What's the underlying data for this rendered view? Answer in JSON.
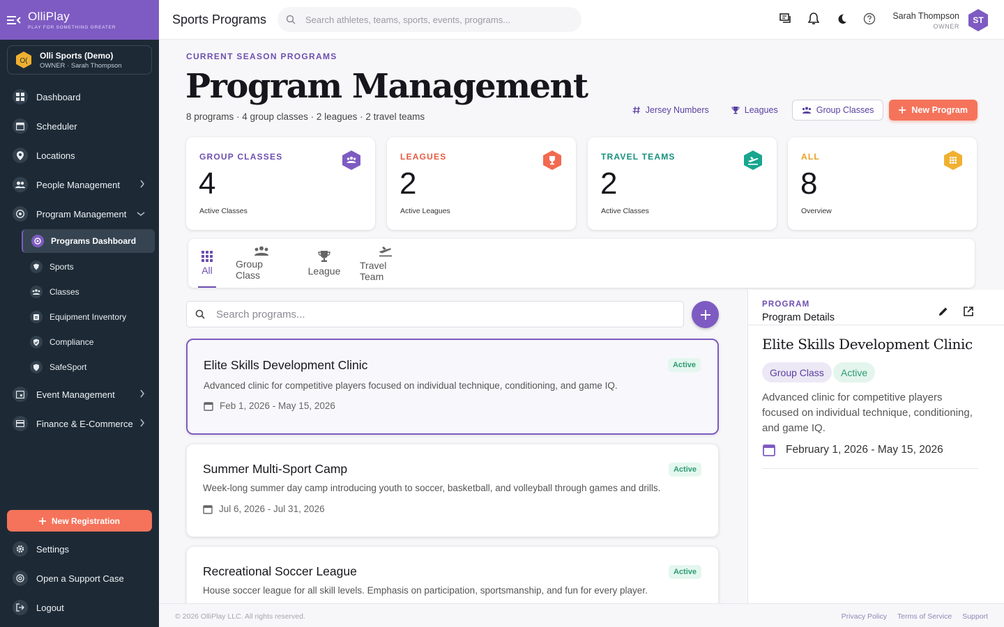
{
  "brand": {
    "name": "OlliPlay",
    "tagline": "PLAY FOR SOMETHING GREATER"
  },
  "org": {
    "name": "Olli Sports (Demo)",
    "subtitle": "OWNER · Sarah Thompson",
    "badge": "O("
  },
  "sidebar": {
    "items": [
      {
        "label": "Dashboard",
        "icon": "dashboard-icon"
      },
      {
        "label": "Scheduler",
        "icon": "calendar-icon"
      },
      {
        "label": "Locations",
        "icon": "location-pin-icon"
      },
      {
        "label": "People Management",
        "icon": "people-icon"
      },
      {
        "label": "Program Management",
        "icon": "sports-ball-icon"
      }
    ],
    "subitems": [
      {
        "label": "Programs Dashboard",
        "icon": "dashboard-icon"
      },
      {
        "label": "Sports",
        "icon": "shield-icon"
      },
      {
        "label": "Classes",
        "icon": "group-icon"
      },
      {
        "label": "Equipment Inventory",
        "icon": "clipboard-icon"
      },
      {
        "label": "Compliance",
        "icon": "shield-check-icon"
      },
      {
        "label": "SafeSport",
        "icon": "shield-icon"
      }
    ],
    "more": [
      {
        "label": "Event Management",
        "icon": "calendar-event-icon"
      },
      {
        "label": "Finance & E-Commerce",
        "icon": "credit-card-icon"
      }
    ],
    "new_registration": "New Registration",
    "bottom": [
      {
        "label": "Settings",
        "icon": "gear-icon"
      },
      {
        "label": "Open a Support Case",
        "icon": "support-icon"
      },
      {
        "label": "Logout",
        "icon": "logout-icon"
      }
    ]
  },
  "topbar": {
    "title": "Sports Programs",
    "search_placeholder": "Search athletes, teams, sports, events, programs...",
    "user_name": "Sarah Thompson",
    "user_role": "OWNER",
    "user_initials": "ST"
  },
  "header": {
    "eyebrow": "CURRENT SEASON PROGRAMS",
    "title": "Program Management",
    "summary": "8 programs · 4 group classes · 2 leagues · 2 travel teams",
    "actions": {
      "jersey": "Jersey Numbers",
      "leagues": "Leagues",
      "group_classes": "Group Classes",
      "new_program": "New Program"
    }
  },
  "stats": [
    {
      "label": "GROUP CLASSES",
      "value": "4",
      "sub": "Active Classes",
      "color": "#7e5bc2"
    },
    {
      "label": "LEAGUES",
      "value": "2",
      "sub": "Active Leagues",
      "color": "#f26a50"
    },
    {
      "label": "TRAVEL TEAMS",
      "value": "2",
      "sub": "Active Classes",
      "color": "#17a68f"
    },
    {
      "label": "ALL",
      "value": "8",
      "sub": "Overview",
      "color": "#f0b030"
    }
  ],
  "tabs": [
    {
      "label": "All"
    },
    {
      "label": "Group Class"
    },
    {
      "label": "League"
    },
    {
      "label": "Travel Team"
    }
  ],
  "list": {
    "search_placeholder": "Search programs...",
    "programs": [
      {
        "title": "Elite Skills Development Clinic",
        "description": "Advanced clinic for competitive players focused on individual technique, conditioning, and game IQ.",
        "dates": "Feb 1, 2026 - May 15, 2026",
        "status": "Active"
      },
      {
        "title": "Summer Multi-Sport Camp",
        "description": "Week-long summer day camp introducing youth to soccer, basketball, and volleyball through games and drills.",
        "dates": "Jul 6, 2026 - Jul 31, 2026",
        "status": "Active"
      },
      {
        "title": "Recreational Soccer League",
        "description": "House soccer league for all skill levels. Emphasis on participation, sportsmanship, and fun for every player.",
        "dates": "",
        "status": "Active"
      }
    ]
  },
  "detail": {
    "eyebrow": "PROGRAM",
    "heading": "Program Details",
    "title": "Elite Skills Development Clinic",
    "type_chip": "Group Class",
    "status_chip": "Active",
    "description": "Advanced clinic for competitive players focused on individual technique, conditioning, and game IQ.",
    "dates": "February 1, 2026 - May 15, 2026"
  },
  "footer": {
    "copyright": "© 2026 OlliPlay LLC. All rights reserved.",
    "links": [
      "Privacy Policy",
      "Terms of Service",
      "Support"
    ]
  }
}
